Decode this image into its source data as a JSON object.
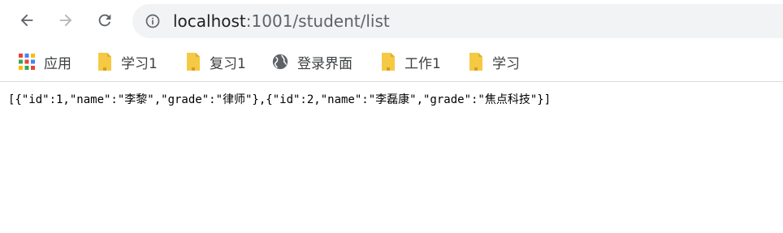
{
  "browser": {
    "url_host": "localhost",
    "url_path": ":1001/student/list"
  },
  "bookmarks": [
    {
      "label": "应用",
      "icon": "apps-grid-icon"
    },
    {
      "label": "学习1",
      "icon": "folder-icon"
    },
    {
      "label": "复习1",
      "icon": "folder-icon"
    },
    {
      "label": "登录界面",
      "icon": "globe-icon"
    },
    {
      "label": "工作1",
      "icon": "folder-icon"
    },
    {
      "label": "学习",
      "icon": "folder-icon"
    }
  ],
  "page": {
    "json_text": "[{\"id\":1,\"name\":\"李黎\",\"grade\":\"律师\"},{\"id\":2,\"name\":\"李磊康\",\"grade\":\"焦点科技\"}]"
  },
  "colors": {
    "icon_gray": "#5f6368",
    "omnibox_bg": "#f1f3f4",
    "folder_yellow": "#f6c945"
  }
}
